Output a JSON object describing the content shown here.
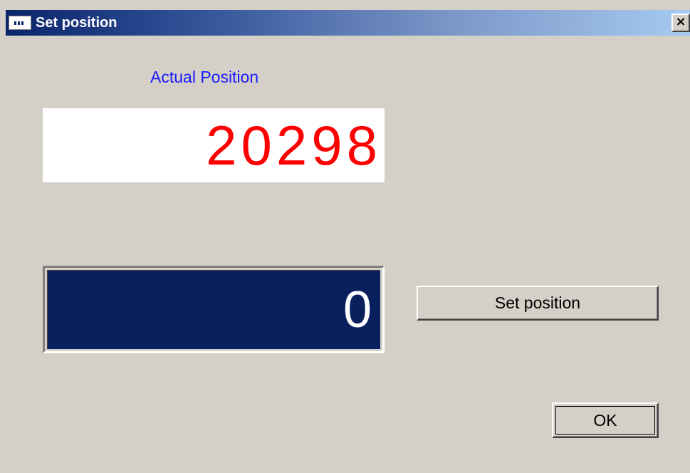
{
  "window": {
    "title": "Set position",
    "close_glyph": "×",
    "icon": "app-window-icon",
    "close_icon": "close-icon"
  },
  "actual_position": {
    "label": "Actual Position",
    "value": "20298",
    "value_color": "#ff0000",
    "label_color": "#1a1aff"
  },
  "new_position": {
    "value": "0",
    "background_color": "#0a1f5e",
    "text_color": "#ffffff"
  },
  "buttons": {
    "set_position_label": "Set position",
    "ok_label": "OK"
  },
  "colors": {
    "dialog_background": "#d4d0c8",
    "titlebar_start": "#0a246a",
    "titlebar_end": "#a6caf0"
  }
}
